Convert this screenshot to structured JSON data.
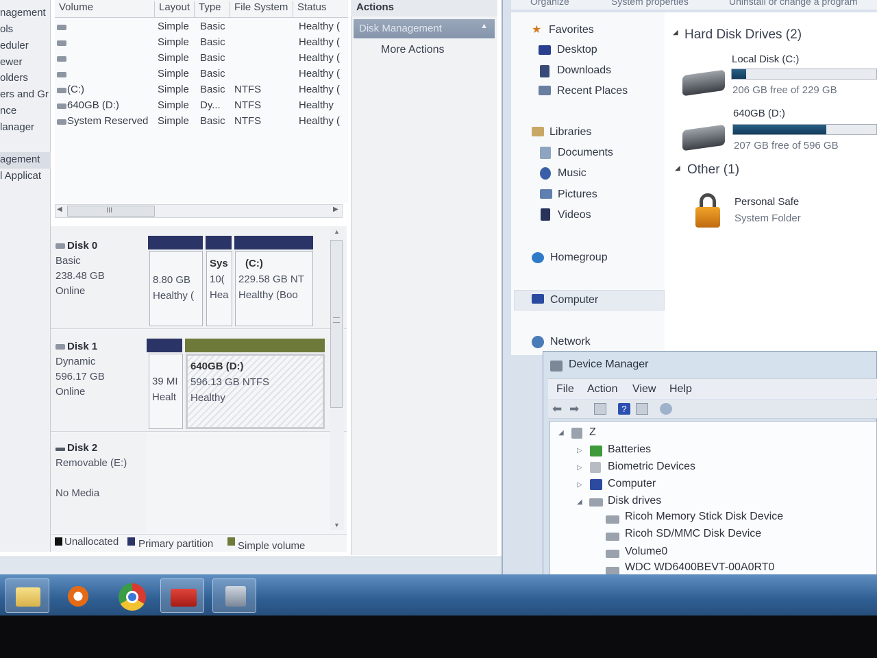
{
  "disk_management": {
    "nav": [
      {
        "label": "nagement",
        "selected": false
      },
      {
        "label": "ols",
        "selected": false
      },
      {
        "label": "eduler",
        "selected": false
      },
      {
        "label": "ewer",
        "selected": false
      },
      {
        "label": "olders",
        "selected": false
      },
      {
        "label": "ers and Gr",
        "selected": false
      },
      {
        "label": "nce",
        "selected": false
      },
      {
        "label": "lanager",
        "selected": false
      },
      {
        "label": "agement",
        "selected": true
      },
      {
        "label": "l Applicat",
        "selected": false
      }
    ],
    "columns": [
      "Volume",
      "Layout",
      "Type",
      "File System",
      "Status"
    ],
    "volumes": [
      {
        "volume": "",
        "layout": "Simple",
        "type": "Basic",
        "fs": "",
        "status": "Healthy ("
      },
      {
        "volume": "",
        "layout": "Simple",
        "type": "Basic",
        "fs": "",
        "status": "Healthy ("
      },
      {
        "volume": "",
        "layout": "Simple",
        "type": "Basic",
        "fs": "",
        "status": "Healthy ("
      },
      {
        "volume": "",
        "layout": "Simple",
        "type": "Basic",
        "fs": "",
        "status": "Healthy ("
      },
      {
        "volume": "(C:)",
        "layout": "Simple",
        "type": "Basic",
        "fs": "NTFS",
        "status": "Healthy ("
      },
      {
        "volume": "640GB (D:)",
        "layout": "Simple",
        "type": "Dy...",
        "fs": "NTFS",
        "status": "Healthy"
      },
      {
        "volume": "System Reserved",
        "layout": "Simple",
        "type": "Basic",
        "fs": "NTFS",
        "status": "Healthy ("
      }
    ],
    "scroll_thumb_glyph": "III",
    "disks": [
      {
        "name": "Disk 0",
        "kind": "Basic",
        "size": "238.48 GB",
        "state": "Online"
      },
      {
        "name": "Disk 1",
        "kind": "Dynamic",
        "size": "596.17 GB",
        "state": "Online"
      },
      {
        "name": "Disk 2",
        "kind": "Removable (E:)",
        "size": "",
        "state": "No Media"
      }
    ],
    "disk0_parts": [
      {
        "title": "",
        "line1": "8.80 GB",
        "line2": "Healthy ("
      },
      {
        "title": "Sys",
        "line1": "10(",
        "line2": "Hea"
      },
      {
        "title": "(C:)",
        "line1": "229.58 GB NT",
        "line2": "Healthy (Boo"
      }
    ],
    "disk1_parts": [
      {
        "title": "",
        "line1": "39 MI",
        "line2": "Healt"
      },
      {
        "title": "640GB  (D:)",
        "line1": "596.13 GB NTFS",
        "line2": "Healthy"
      }
    ],
    "legend": [
      "Unallocated",
      "Primary partition",
      "Simple volume"
    ],
    "actions_title": "Actions",
    "actions_section": "Disk Management",
    "more_actions": "More Actions"
  },
  "explorer": {
    "toolbar": [
      "Organize",
      "System properties",
      "Uninstall or change a program"
    ],
    "nav": {
      "favorites": "Favorites",
      "desktop": "Desktop",
      "downloads": "Downloads",
      "recent": "Recent Places",
      "libraries": "Libraries",
      "documents": "Documents",
      "music": "Music",
      "pictures": "Pictures",
      "videos": "Videos",
      "homegroup": "Homegroup",
      "computer": "Computer",
      "network": "Network"
    },
    "groups": {
      "hdd_title": "Hard Disk Drives (2)",
      "other_title": "Other (1)"
    },
    "drives": [
      {
        "name": "Local Disk (C:)",
        "free": "206 GB free of 229 GB",
        "used_fraction": 0.1
      },
      {
        "name": "640GB (D:)",
        "free": "207 GB free of 596 GB",
        "used_fraction": 0.65
      }
    ],
    "other_item": {
      "name": "Personal Safe",
      "type": "System Folder"
    }
  },
  "device_manager": {
    "title": "Device Manager",
    "menu": [
      "File",
      "Action",
      "View",
      "Help"
    ],
    "tree": {
      "root": "Z",
      "children": [
        "Batteries",
        "Biometric Devices",
        "Computer",
        "Disk drives"
      ],
      "disk_drives": [
        "Ricoh Memory Stick Disk Device",
        "Ricoh SD/MMC Disk Device",
        "Volume0",
        "WDC WD6400BEVT-00A0RT0"
      ]
    }
  },
  "taskbar": {
    "apps": [
      "explorer-icon",
      "media-player-icon",
      "chrome-icon",
      "toolbox-icon",
      "device-manager-icon"
    ]
  },
  "colors": {
    "partition_bar": "#2b3466",
    "simple_volume_bar": "#6e7a3a",
    "taskbar": "#2f5f93"
  }
}
